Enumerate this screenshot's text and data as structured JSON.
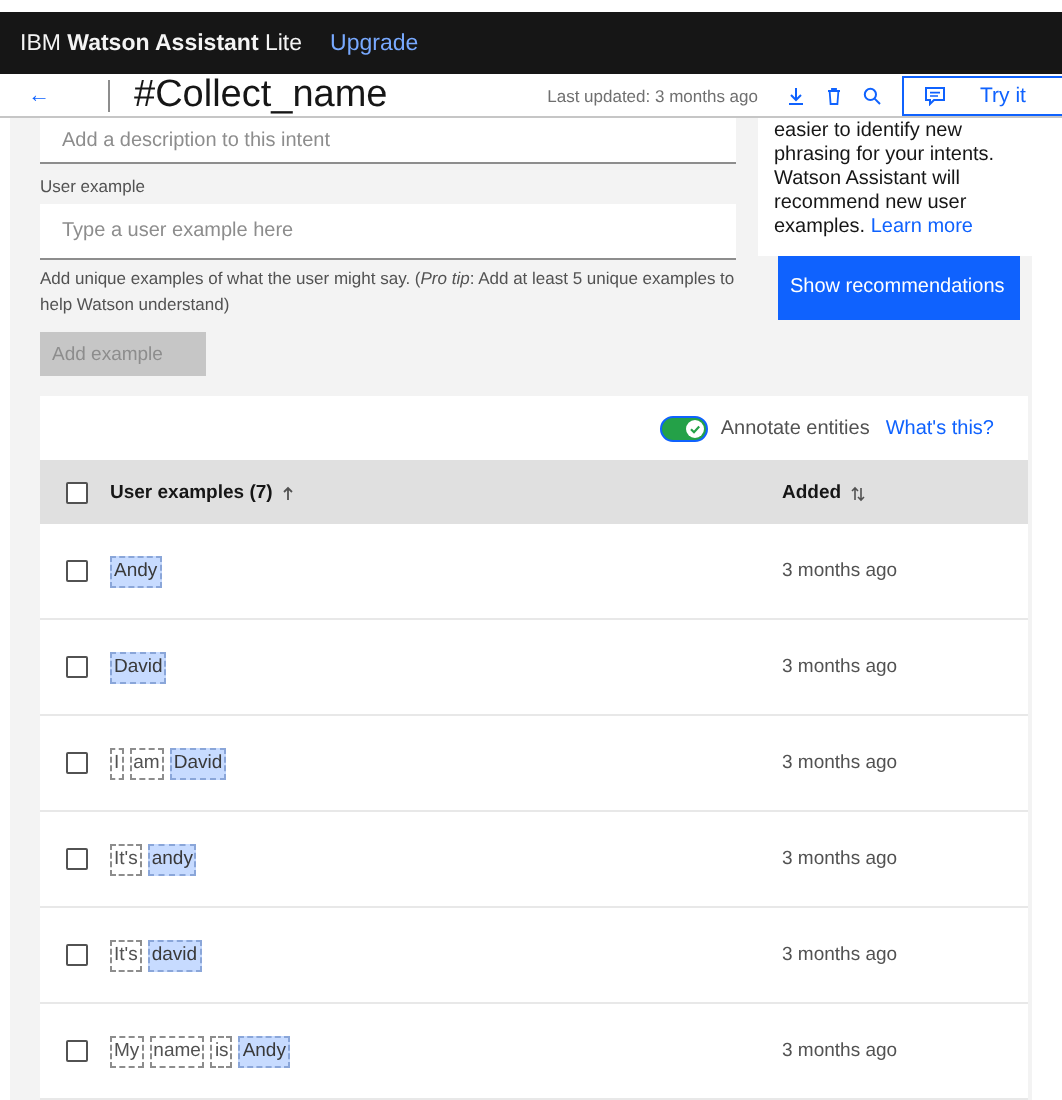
{
  "topbar": {
    "brand_prefix": "IBM",
    "brand_name": "Watson Assistant",
    "brand_plan": "Lite",
    "upgrade_link": "Upgrade"
  },
  "header": {
    "back": "←",
    "title": "#Collect_name",
    "last_updated": "Last updated: 3 months ago",
    "try_button": "Try it"
  },
  "form": {
    "description_placeholder": "Add a description to this intent",
    "example_label": "User example",
    "example_placeholder": "Type a user example here",
    "help_text": "Add unique examples of what the user might say. (*Pro tip*: Add at least 5 unique examples to help Watson understand)",
    "add_button": "Add example",
    "add_disabled": true
  },
  "recommendations": {
    "text": "easier to identify new phrasing for your intents. Watson Assistant will recommend new user examples.",
    "link": "Learn more",
    "button": "Show recommendations"
  },
  "annotate": {
    "label": "Annotate entities",
    "on": true,
    "help_link": "What's this?"
  },
  "table": {
    "select_all_checked": false,
    "columns": [
      {
        "label": "User examples (7)",
        "sorted": true
      },
      {
        "label": "Added",
        "sorted": false
      }
    ],
    "rows": [
      {
        "checked": false,
        "tokens": [
          {
            "text": "Andy",
            "kind": "entity"
          }
        ],
        "added": "3 months ago"
      },
      {
        "checked": false,
        "tokens": [
          {
            "text": "David",
            "kind": "entity"
          }
        ],
        "added": "3 months ago"
      },
      {
        "checked": false,
        "tokens": [
          {
            "text": "I",
            "kind": "word"
          },
          {
            "text": "am",
            "kind": "word"
          },
          {
            "text": "David",
            "kind": "entity"
          }
        ],
        "added": "3 months ago"
      },
      {
        "checked": false,
        "tokens": [
          {
            "text": "It's",
            "kind": "word"
          },
          {
            "text": "andy",
            "kind": "entity"
          }
        ],
        "added": "3 months ago"
      },
      {
        "checked": false,
        "tokens": [
          {
            "text": "It's",
            "kind": "word"
          },
          {
            "text": "david",
            "kind": "entity"
          }
        ],
        "added": "3 months ago"
      },
      {
        "checked": false,
        "tokens": [
          {
            "text": "My",
            "kind": "word"
          },
          {
            "text": "name",
            "kind": "word"
          },
          {
            "text": "is",
            "kind": "word"
          },
          {
            "text": "Andy",
            "kind": "entity"
          }
        ],
        "added": "3 months ago"
      }
    ]
  }
}
